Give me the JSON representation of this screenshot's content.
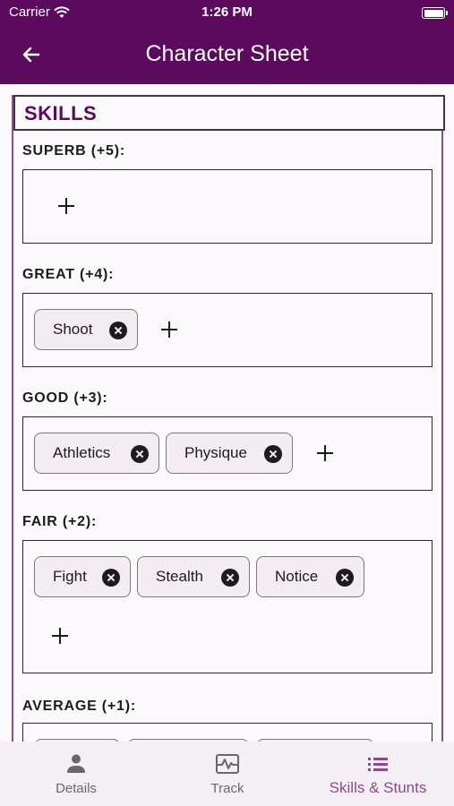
{
  "status_bar": {
    "carrier": "Carrier",
    "time": "1:26 PM"
  },
  "app_bar": {
    "title": "Character Sheet"
  },
  "section": {
    "title": "SKILLS"
  },
  "tiers": [
    {
      "label": "SUPERB (+5):",
      "skills": []
    },
    {
      "label": "GREAT (+4):",
      "skills": [
        "Shoot"
      ]
    },
    {
      "label": "GOOD (+3):",
      "skills": [
        "Athletics",
        "Physique"
      ]
    },
    {
      "label": "FAIR (+2):",
      "skills": [
        "Fight",
        "Stealth",
        "Notice"
      ]
    },
    {
      "label": "AVERAGE (+1):",
      "skills": []
    }
  ],
  "bottom_nav": {
    "items": [
      {
        "label": "Details",
        "icon": "person-icon"
      },
      {
        "label": "Track",
        "icon": "track-icon"
      },
      {
        "label": "Skills & Stunts",
        "icon": "list-icon",
        "active": true
      }
    ]
  },
  "colors": {
    "primary": "#5c0a5e",
    "accent": "#8b4a8d",
    "background": "#fcf9fc"
  }
}
